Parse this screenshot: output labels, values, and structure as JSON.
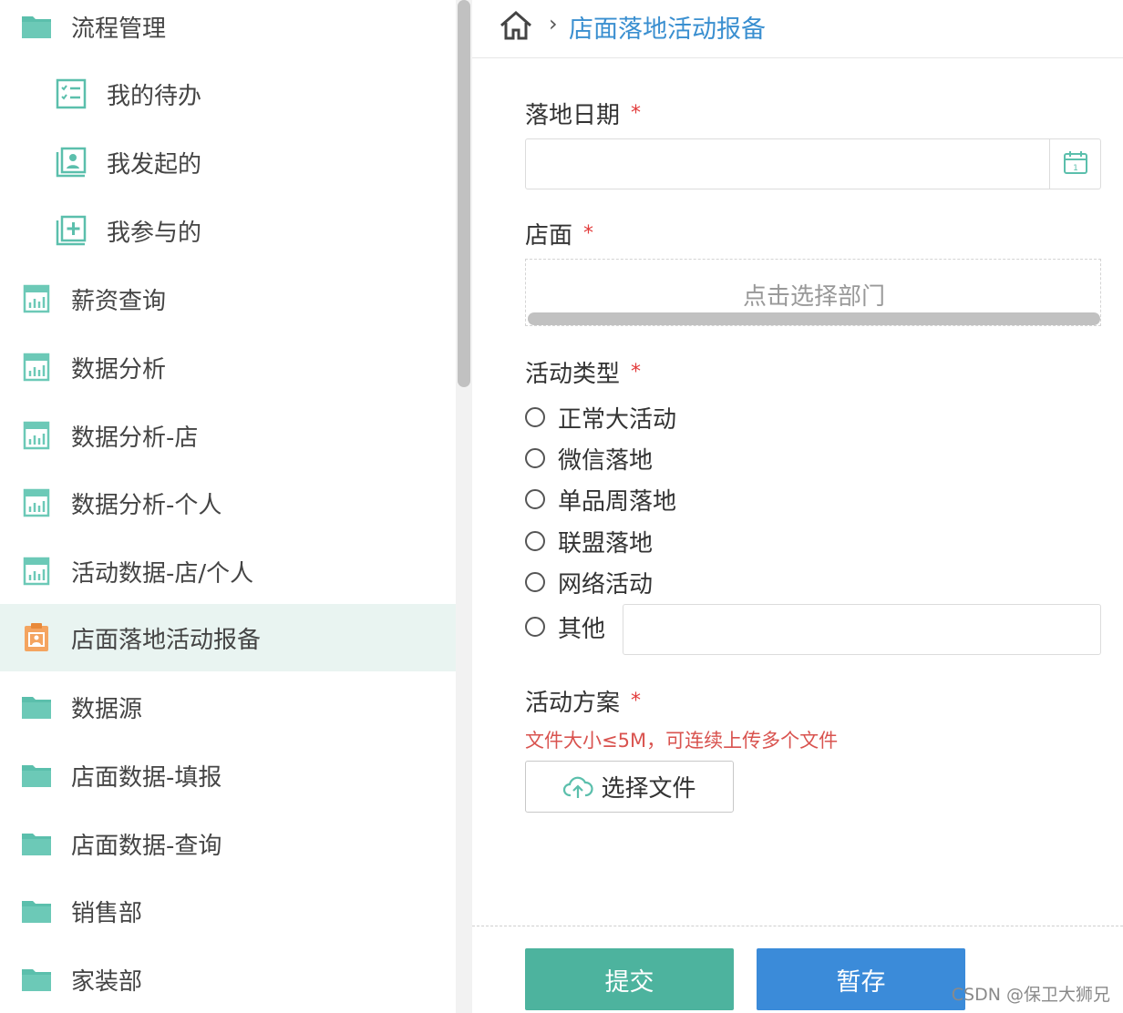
{
  "sidebar": {
    "items": [
      {
        "label": "流程管理",
        "icon": "folder-icon"
      },
      {
        "label": "我的待办",
        "icon": "checklist-icon"
      },
      {
        "label": "我发起的",
        "icon": "user-card-icon"
      },
      {
        "label": "我参与的",
        "icon": "plus-box-icon"
      },
      {
        "label": "薪资查询",
        "icon": "report-icon"
      },
      {
        "label": "数据分析",
        "icon": "report-icon"
      },
      {
        "label": "数据分析-店",
        "icon": "report-icon"
      },
      {
        "label": "数据分析-个人",
        "icon": "report-icon"
      },
      {
        "label": "活动数据-店/个人",
        "icon": "report-icon"
      },
      {
        "label": "店面落地活动报备",
        "icon": "form-icon",
        "active": true
      },
      {
        "label": "数据源",
        "icon": "folder-icon"
      },
      {
        "label": "店面数据-填报",
        "icon": "folder-icon"
      },
      {
        "label": "店面数据-查询",
        "icon": "folder-icon"
      },
      {
        "label": "销售部",
        "icon": "folder-icon"
      },
      {
        "label": "家装部",
        "icon": "folder-icon"
      }
    ]
  },
  "breadcrumb": {
    "separator": "›",
    "current": "店面落地活动报备"
  },
  "form": {
    "required_mark": "*",
    "date": {
      "label": "落地日期",
      "value": ""
    },
    "store": {
      "label": "店面",
      "placeholder": "点击选择部门"
    },
    "activity_type": {
      "label": "活动类型",
      "options": [
        "正常大活动",
        "微信落地",
        "单品周落地",
        "联盟落地",
        "网络活动",
        "其他"
      ],
      "other_value": ""
    },
    "plan": {
      "label": "活动方案",
      "hint": "文件大小≤5M，可连续上传多个文件",
      "button": "选择文件"
    }
  },
  "actions": {
    "submit": "提交",
    "save": "暂存"
  },
  "watermark": "CSDN @保卫大狮兄",
  "colors": {
    "accent": "#4db39e",
    "link": "#3a8fd0",
    "primary": "#3b8bd9",
    "required": "#e23c3c",
    "active_bg": "#e9f4f1"
  }
}
